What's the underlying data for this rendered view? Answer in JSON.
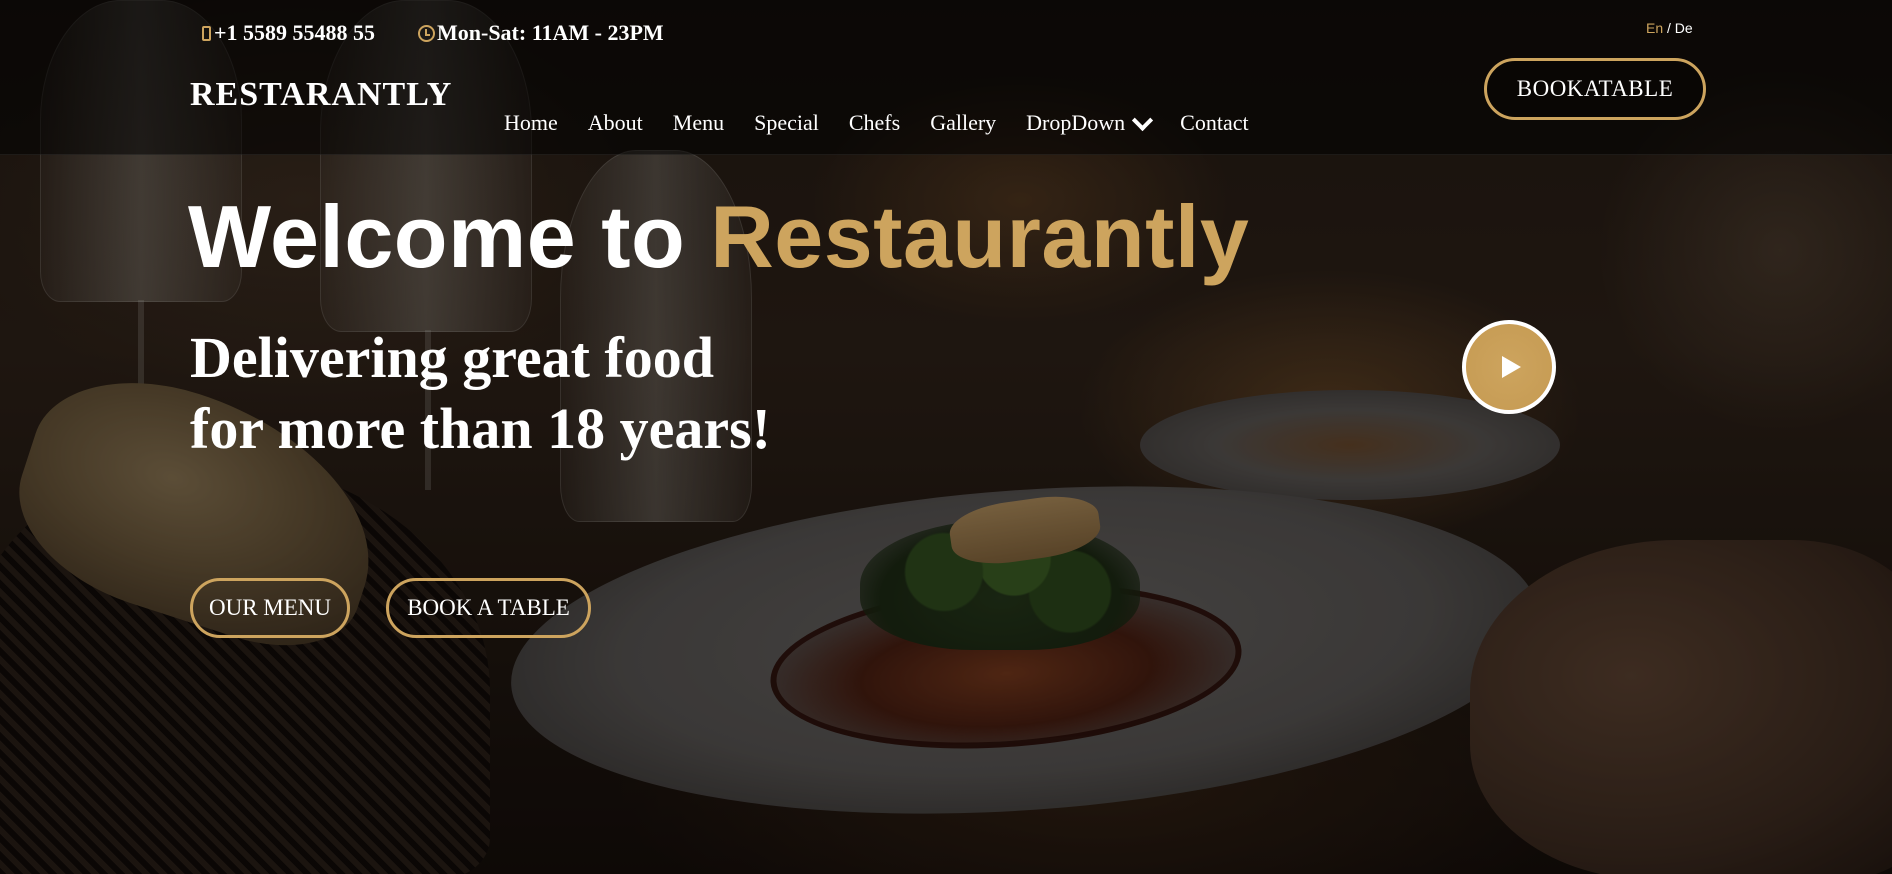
{
  "topbar": {
    "phone": "+1 5589 55488 55",
    "hours": "Mon-Sat: 11AM - 23PM",
    "lang_active": "En",
    "lang_separator": " / ",
    "lang_other": "De"
  },
  "header": {
    "logo": "RESTARANTLY",
    "nav": [
      "Home",
      "About",
      "Menu",
      "Special",
      "Chefs",
      "Gallery",
      "DropDown",
      "Contact"
    ],
    "book_button": "BOOKATABLE"
  },
  "hero": {
    "title_prefix": "Welcome to ",
    "title_accent": "Restaurantly",
    "subtitle": "Delivering great food for more than 18 years!",
    "btn_menu": "OUR MENU",
    "btn_table": "BOOK A TABLE"
  },
  "icons": {
    "phone": "phone-icon",
    "clock": "clock-icon",
    "dropdown": "chevron-down-icon",
    "play": "play-icon"
  },
  "colors": {
    "accent": "#cda45e",
    "text": "#ffffff",
    "header_bg": "#000000"
  }
}
